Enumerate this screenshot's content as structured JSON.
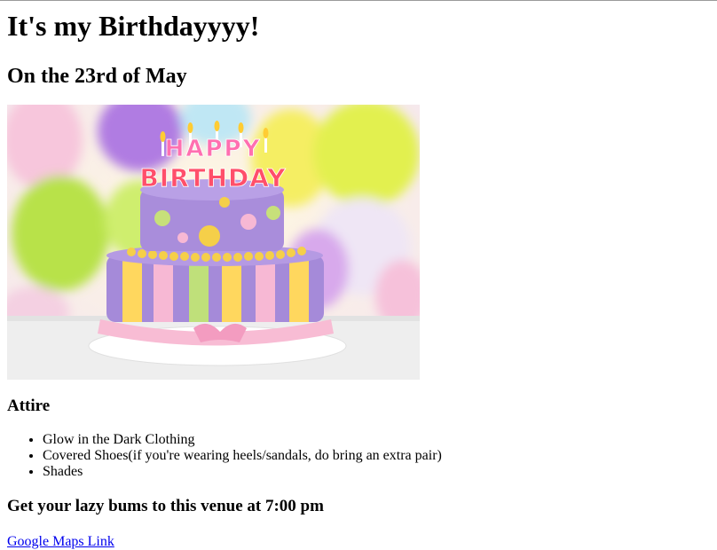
{
  "page": {
    "title": "It's my Birthdayyyy!",
    "date_heading": "On the 23rd of May"
  },
  "hero": {
    "icon": "birthday-cake-image",
    "cake_text": "HAPPY BIRTHDAY",
    "letter_colors": [
      "#ff5fa8",
      "#ffd23a",
      "#6fd6ff",
      "#ff7a3a",
      "#b76cff",
      "#7ee07a"
    ]
  },
  "attire": {
    "heading": "Attire",
    "items": [
      "Glow in the Dark Clothing",
      "Covered Shoes(if you're wearing heels/sandals, do bring an extra pair)",
      "Shades"
    ]
  },
  "venue": {
    "heading": "Get your lazy bums to this venue at 7:00 pm",
    "link_label": "Google Maps Link",
    "link_color": "#0000ee"
  }
}
